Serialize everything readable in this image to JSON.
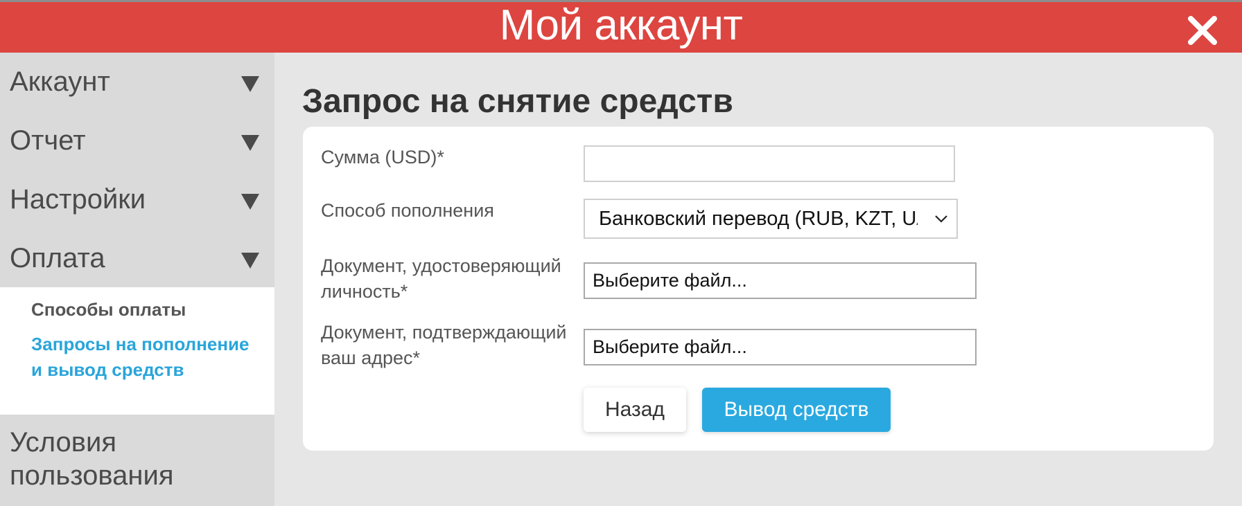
{
  "header": {
    "title": "Мой аккаунт",
    "close_icon": "close-icon"
  },
  "sidebar": {
    "items": [
      {
        "label": "Аккаунт",
        "icon": "triangle-down-icon"
      },
      {
        "label": "Отчет",
        "icon": "triangle-down-icon"
      },
      {
        "label": "Настройки",
        "icon": "triangle-down-icon"
      },
      {
        "label": "Оплата",
        "icon": "triangle-down-icon"
      }
    ],
    "payment_submenu": [
      {
        "label": "Способы оплаты"
      },
      {
        "label": "Запросы на пополнение и вывод средств"
      }
    ],
    "terms": "Условия пользования"
  },
  "main": {
    "title": "Запрос на снятие средств",
    "form": {
      "amount_label": "Сумма (USD)*",
      "amount_value": "",
      "method_label": "Способ пополнения",
      "method_value": "Банковский перевод (RUB, KZT, UAH",
      "id_doc_label": "Документ, удостоверяющий личность*",
      "id_doc_value": "Выберите файл...",
      "address_doc_label": "Документ, подтверждающий ваш адрес*",
      "address_doc_value": "Выберите файл...",
      "back_button": "Назад",
      "submit_button": "Вывод средств"
    }
  },
  "colors": {
    "header_bg": "#dd4540",
    "accent_blue": "#2aa9e0",
    "sidebar_bg": "#dadada",
    "content_bg": "#e6e6e6"
  }
}
